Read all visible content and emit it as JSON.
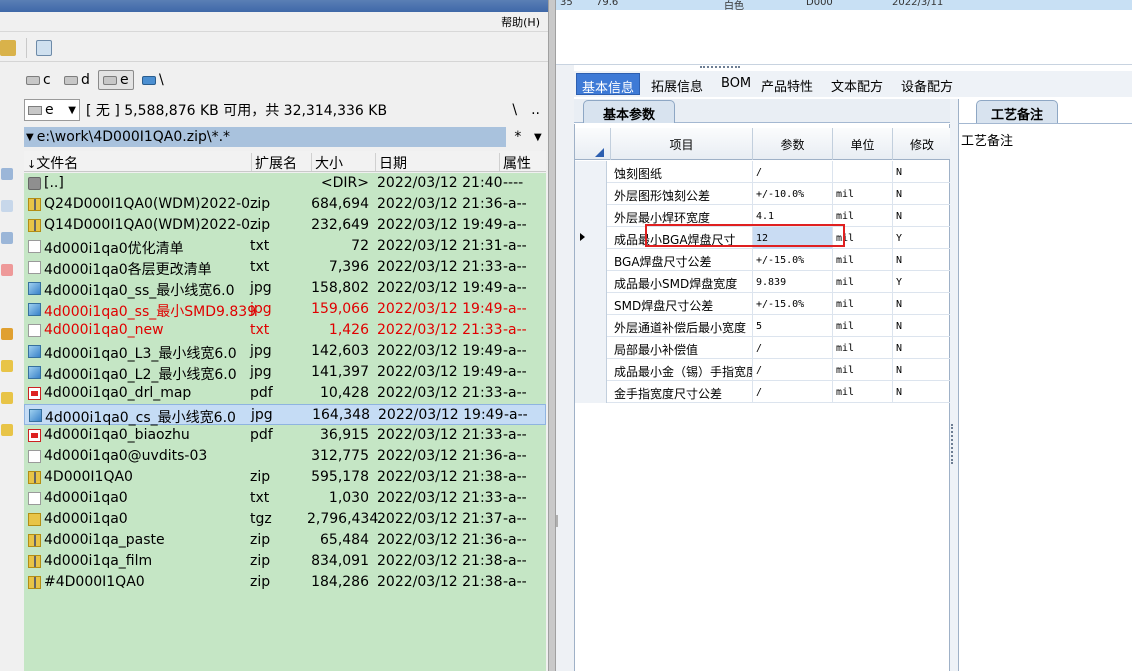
{
  "left_panel": {
    "menu": {
      "help_label": "帮助(H)"
    },
    "drives": [
      {
        "letter": "c",
        "selected": false
      },
      {
        "letter": "d",
        "selected": false
      },
      {
        "letter": "e",
        "selected": true
      },
      {
        "letter": "\\",
        "selected": false
      }
    ],
    "drive_select": {
      "value": "e"
    },
    "space_info": "[ 无 ]  5,588,876 KB 可用，共 32,314,336 KB",
    "path_buttons": [
      "\\",
      ".."
    ],
    "path": "e:\\work\\4D000I1QA0.zip\\*.*",
    "path_star": "*",
    "columns": {
      "name": "文件名",
      "ext": "扩展名",
      "size": "大小",
      "date": "日期",
      "attr": "属性"
    },
    "files": [
      {
        "icon": "up",
        "name": "[..]",
        "ext": "",
        "size": "<DIR>",
        "date": "2022/03/12 21:40",
        "attr": "----",
        "style": "normal"
      },
      {
        "icon": "zip",
        "name": "Q24D000I1QA0(WDM)2022-0..",
        "ext": "zip",
        "size": "684,694",
        "date": "2022/03/12 21:36",
        "attr": "-a--",
        "style": "normal"
      },
      {
        "icon": "zip",
        "name": "Q14D000I1QA0(WDM)2022-0..",
        "ext": "zip",
        "size": "232,649",
        "date": "2022/03/12 19:49",
        "attr": "-a--",
        "style": "normal"
      },
      {
        "icon": "txt",
        "name": "4d000i1qa0优化清单",
        "ext": "txt",
        "size": "72",
        "date": "2022/03/12 21:31",
        "attr": "-a--",
        "style": "normal"
      },
      {
        "icon": "txt",
        "name": "4d000i1qa0各层更改清单",
        "ext": "txt",
        "size": "7,396",
        "date": "2022/03/12 21:33",
        "attr": "-a--",
        "style": "normal"
      },
      {
        "icon": "jpg",
        "name": "4d000i1qa0_ss_最小线宽6.0",
        "ext": "jpg",
        "size": "158,802",
        "date": "2022/03/12 19:49",
        "attr": "-a--",
        "style": "normal"
      },
      {
        "icon": "jpg",
        "name": "4d000i1qa0_ss_最小SMD9.839",
        "ext": "jpg",
        "size": "159,066",
        "date": "2022/03/12 19:49",
        "attr": "-a--",
        "style": "red"
      },
      {
        "icon": "txt",
        "name": "4d000i1qa0_new",
        "ext": "txt",
        "size": "1,426",
        "date": "2022/03/12 21:33",
        "attr": "-a--",
        "style": "red"
      },
      {
        "icon": "jpg",
        "name": "4d000i1qa0_L3_最小线宽6.0",
        "ext": "jpg",
        "size": "142,603",
        "date": "2022/03/12 19:49",
        "attr": "-a--",
        "style": "normal"
      },
      {
        "icon": "jpg",
        "name": "4d000i1qa0_L2_最小线宽6.0",
        "ext": "jpg",
        "size": "141,397",
        "date": "2022/03/12 19:49",
        "attr": "-a--",
        "style": "normal"
      },
      {
        "icon": "pdf",
        "name": "4d000i1qa0_drl_map",
        "ext": "pdf",
        "size": "10,428",
        "date": "2022/03/12 21:33",
        "attr": "-a--",
        "style": "normal"
      },
      {
        "icon": "jpg",
        "name": "4d000i1qa0_cs_最小线宽6.0",
        "ext": "jpg",
        "size": "164,348",
        "date": "2022/03/12 19:49",
        "attr": "-a--",
        "style": "selected"
      },
      {
        "icon": "pdf",
        "name": "4d000i1qa0_biaozhu",
        "ext": "pdf",
        "size": "36,915",
        "date": "2022/03/12 21:33",
        "attr": "-a--",
        "style": "normal"
      },
      {
        "icon": "txt",
        "name": "4d000i1qa0@uvdits-03",
        "ext": "",
        "size": "312,775",
        "date": "2022/03/12 21:36",
        "attr": "-a--",
        "style": "normal"
      },
      {
        "icon": "zip",
        "name": "4D000I1QA0",
        "ext": "zip",
        "size": "595,178",
        "date": "2022/03/12 21:38",
        "attr": "-a--",
        "style": "normal"
      },
      {
        "icon": "txt",
        "name": "4d000i1qa0",
        "ext": "txt",
        "size": "1,030",
        "date": "2022/03/12 21:33",
        "attr": "-a--",
        "style": "normal"
      },
      {
        "icon": "tgz",
        "name": "4d000i1qa0",
        "ext": "tgz",
        "size": "2,796,434",
        "date": "2022/03/12 21:37",
        "attr": "-a--",
        "style": "normal"
      },
      {
        "icon": "zip",
        "name": "4d000i1qa_paste",
        "ext": "zip",
        "size": "65,484",
        "date": "2022/03/12 21:36",
        "attr": "-a--",
        "style": "normal"
      },
      {
        "icon": "zip",
        "name": "4d000i1qa_film",
        "ext": "zip",
        "size": "834,091",
        "date": "2022/03/12 21:38",
        "attr": "-a--",
        "style": "normal"
      },
      {
        "icon": "zip",
        "name": "#4D000I1QA0",
        "ext": "zip",
        "size": "184,286",
        "date": "2022/03/12 21:38",
        "attr": "-a--",
        "style": "normal"
      }
    ]
  },
  "right_panel": {
    "top_row": {
      "c1": "35",
      "c2": "79.6",
      "c3": "白色",
      "c4": "D000",
      "c5": "2022/3/11"
    },
    "tabs": [
      {
        "label": "基本信息",
        "active": true
      },
      {
        "label": "拓展信息",
        "active": false
      },
      {
        "label": "BOM",
        "active": false
      },
      {
        "label": "产品特性",
        "active": false
      },
      {
        "label": "文本配方",
        "active": false
      },
      {
        "label": "设备配方",
        "active": false
      }
    ],
    "subtab": "基本参数",
    "grid": {
      "headers": {
        "item": "项目",
        "param": "参数",
        "unit": "单位",
        "modify": "修改"
      },
      "rows": [
        {
          "item": "蚀刻图纸",
          "param": "/",
          "unit": "",
          "modify": "N",
          "current": false
        },
        {
          "item": "外层图形蚀刻公差",
          "param": "+/-10.0%",
          "unit": "mil",
          "modify": "N",
          "current": false
        },
        {
          "item": "外层最小焊环宽度",
          "param": "4.1",
          "unit": "mil",
          "modify": "N",
          "current": false
        },
        {
          "item": "成品最小BGA焊盘尺寸",
          "param": "12",
          "unit": "mil",
          "modify": "Y",
          "current": true
        },
        {
          "item": "BGA焊盘尺寸公差",
          "param": "+/-15.0%",
          "unit": "mil",
          "modify": "N",
          "current": false
        },
        {
          "item": "成品最小SMD焊盘宽度",
          "param": "9.839",
          "unit": "mil",
          "modify": "Y",
          "current": false
        },
        {
          "item": "SMD焊盘尺寸公差",
          "param": "+/-15.0%",
          "unit": "mil",
          "modify": "N",
          "current": false
        },
        {
          "item": "外层通道补偿后最小宽度",
          "param": "5",
          "unit": "mil",
          "modify": "N",
          "current": false
        },
        {
          "item": "局部最小补偿值",
          "param": "/",
          "unit": "mil",
          "modify": "N",
          "current": false
        },
        {
          "item": "成品最小金（锡）手指宽度",
          "param": "/",
          "unit": "mil",
          "modify": "N",
          "current": false
        },
        {
          "item": "金手指宽度尺寸公差",
          "param": "/",
          "unit": "mil",
          "modify": "N",
          "current": false
        }
      ]
    },
    "process_note": {
      "tab": "工艺备注",
      "label": "工艺备注"
    }
  },
  "colors": {
    "file_list_bg": "#c5e6c5",
    "red_text": "#e00000",
    "active_tab": "#3e7ad6",
    "highlight_box": "#e02020"
  }
}
